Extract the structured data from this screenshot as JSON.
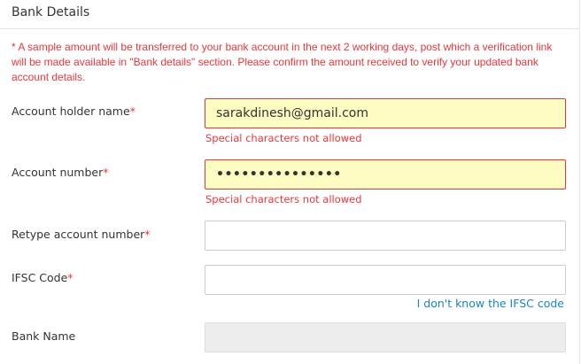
{
  "section": {
    "title": "Bank Details"
  },
  "notice": "* A sample amount will be transferred to your bank account in the next 2 working days, post which a verification link will be made available in \"Bank details\" section. Please confirm the amount received to verify your updated bank account details.",
  "required_mark": "*",
  "fields": {
    "account_holder": {
      "label": "Account holder name",
      "value": "sarakdinesh@gmail.com",
      "error": "Special characters not allowed"
    },
    "account_number": {
      "label": "Account number",
      "value": "•••••••••••••••",
      "error": "Special characters not allowed"
    },
    "retype_account_number": {
      "label": "Retype account number",
      "value": ""
    },
    "ifsc_code": {
      "label": "IFSC Code",
      "value": "",
      "help_link": "I don't know the IFSC code"
    },
    "bank_name": {
      "label": "Bank Name",
      "value": ""
    }
  },
  "colors": {
    "error": "#e8373c",
    "error_field_bg": "#fbfbc2",
    "link": "#1b84c4",
    "disabled_bg": "#ededed"
  }
}
